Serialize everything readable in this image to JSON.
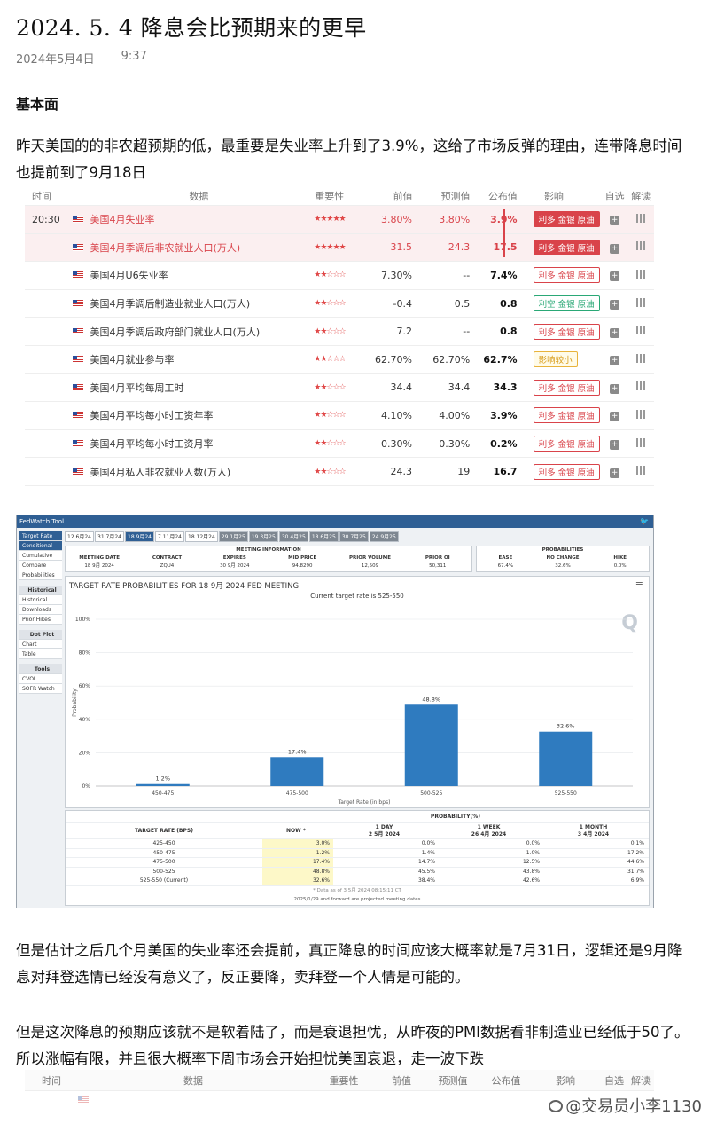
{
  "article": {
    "title": "2024. 5. 4  降息会比预期来的更早",
    "date": "2024年5月4日",
    "time": "9:37",
    "section_title": "基本面",
    "para1": "昨天美国的的非农超预期的低，最重要是失业率上升到了3.9%，这给了市场反弹的理由，连带降息时间也提前到了9月18日",
    "para2": "但是估计之后几个月美国的失业率还会提前，真正降息的时间应该大概率就是7月31日，逻辑还是9月降息对拜登选情已经没有意义了，反正要降，卖拜登一个人情是可能的。",
    "para3": "但是这次降息的预期应该就不是软着陆了，而是衰退担忧，从昨夜的PMI数据看非制造业已经低于50了。所以涨幅有限，并且很大概率下周市场会开始担忧美国衰退，走一波下跌"
  },
  "calendar": {
    "headers": {
      "time": "时间",
      "data": "数据",
      "importance": "重要性",
      "prev": "前值",
      "forecast": "预测值",
      "actual": "公布值",
      "impact": "影响",
      "watch": "自选",
      "explain": "解读"
    },
    "rows": [
      {
        "time": "20:30",
        "name": "美国4月失业率",
        "stars": "★★★★★",
        "prev": "3.80%",
        "forecast": "3.80%",
        "actual": "3.9%",
        "impact": "利多 金银 原油",
        "style": "solid",
        "hl": true
      },
      {
        "time": "",
        "name": "美国4月季调后非农就业人口(万人)",
        "stars": "★★★★★",
        "prev": "31.5",
        "forecast": "24.3",
        "actual": "17.5",
        "impact": "利多 金银 原油",
        "style": "solid",
        "hl": true
      },
      {
        "time": "",
        "name": "美国4月U6失业率",
        "stars": "★★☆☆☆",
        "prev": "7.30%",
        "forecast": "--",
        "actual": "7.4%",
        "impact": "利多 金银 原油",
        "style": "outline",
        "hl": false
      },
      {
        "time": "",
        "name": "美国4月季调后制造业就业人口(万人)",
        "stars": "★★☆☆☆",
        "prev": "-0.4",
        "forecast": "0.5",
        "actual": "0.8",
        "impact": "利空 金银 原油",
        "style": "green",
        "hl": false
      },
      {
        "time": "",
        "name": "美国4月季调后政府部门就业人口(万人)",
        "stars": "★★☆☆☆",
        "prev": "7.2",
        "forecast": "--",
        "actual": "0.8",
        "impact": "利多 金银 原油",
        "style": "outline",
        "hl": false
      },
      {
        "time": "",
        "name": "美国4月就业参与率",
        "stars": "★★☆☆☆",
        "prev": "62.70%",
        "forecast": "62.70%",
        "actual": "62.7%",
        "impact": "影响较小",
        "style": "yellow",
        "hl": false
      },
      {
        "time": "",
        "name": "美国4月平均每周工时",
        "stars": "★★☆☆☆",
        "prev": "34.4",
        "forecast": "34.4",
        "actual": "34.3",
        "impact": "利多 金银 原油",
        "style": "outline",
        "hl": false
      },
      {
        "time": "",
        "name": "美国4月平均每小时工资年率",
        "stars": "★★☆☆☆",
        "prev": "4.10%",
        "forecast": "4.00%",
        "actual": "3.9%",
        "impact": "利多 金银 原油",
        "style": "outline",
        "hl": false
      },
      {
        "time": "",
        "name": "美国4月平均每小时工资月率",
        "stars": "★★☆☆☆",
        "prev": "0.30%",
        "forecast": "0.30%",
        "actual": "0.2%",
        "impact": "利多 金银 原油",
        "style": "outline",
        "hl": false
      },
      {
        "time": "",
        "name": "美国4月私人非农就业人数(万人)",
        "stars": "★★☆☆☆",
        "prev": "24.3",
        "forecast": "19",
        "actual": "16.7",
        "impact": "利多 金银 原油",
        "style": "outline",
        "hl": false
      }
    ]
  },
  "fedwatch": {
    "app_title": "FedWatch Tool",
    "twitter": "🐦",
    "tabs": [
      "12 6月24",
      "31 7月24",
      "18 9月24",
      "7 11月24",
      "18 12月24",
      "29 1月25",
      "19 3月25",
      "30 4月25",
      "18 6月25",
      "30 7月25",
      "24 9月25"
    ],
    "side_top": "Target Rate",
    "side_items": [
      "Conditional",
      "Cumulative",
      "Compare",
      "Probabilities"
    ],
    "side_hist": "Historical",
    "side_hist_items": [
      "Historical",
      "Downloads",
      "Prior Hikes"
    ],
    "side_dot": "Dot Plot",
    "side_dot_items": [
      "Chart",
      "Table"
    ],
    "side_tools": "Tools",
    "side_tools_items": [
      "CVOL",
      "SOFR Watch"
    ],
    "meeting_info_label": "MEETING INFORMATION",
    "meeting_headers": [
      "MEETING DATE",
      "CONTRACT",
      "EXPIRES",
      "MID PRICE",
      "PRIOR VOLUME",
      "PRIOR OI"
    ],
    "meeting_values": [
      "18 9月 2024",
      "ZQU4",
      "30 9月 2024",
      "94.8290",
      "12,509",
      "50,311"
    ],
    "prob_label": "PROBABILITIES",
    "prob_headers": [
      "EASE",
      "NO CHANGE",
      "HIKE"
    ],
    "prob_values": [
      "67.4%",
      "32.6%",
      "0.0%"
    ],
    "menu_icon": "≡",
    "logo_glyph": "Q",
    "table": {
      "col_target": "TARGET RATE (BPS)",
      "col_prob": "PROBABILITY(%)",
      "col_now": "NOW *",
      "col_1day": "1 DAY",
      "col_1day_date": "2 5月 2024",
      "col_1week": "1 WEEK",
      "col_1week_date": "26 4月 2024",
      "col_1month": "1 MONTH",
      "col_1month_date": "3 4月 2024",
      "rows": [
        {
          "rate": "425-450",
          "now": "3.0%",
          "d1": "0.0%",
          "w1": "0.0%",
          "m1": "0.1%"
        },
        {
          "rate": "450-475",
          "now": "1.2%",
          "d1": "1.4%",
          "w1": "1.0%",
          "m1": "17.2%"
        },
        {
          "rate": "475-500",
          "now": "17.4%",
          "d1": "14.7%",
          "w1": "12.5%",
          "m1": "44.6%"
        },
        {
          "rate": "500-525",
          "now": "48.8%",
          "d1": "45.5%",
          "w1": "43.8%",
          "m1": "31.7%"
        },
        {
          "rate": "525-550 (Current)",
          "now": "32.6%",
          "d1": "38.4%",
          "w1": "42.6%",
          "m1": "6.9%"
        }
      ],
      "note": "* Data as of 3 5月 2024 08:15:11 CT",
      "footer": "2025/1/29 and forward are projected meeting dates"
    }
  },
  "chart_data": {
    "type": "bar",
    "title": "TARGET RATE PROBABILITIES FOR 18 9月 2024 FED MEETING",
    "subtitle": "Current target rate is 525-550",
    "categories": [
      "450-475",
      "475-500",
      "500-525",
      "525-550"
    ],
    "values": [
      1.2,
      17.4,
      48.8,
      32.6
    ],
    "data_labels": [
      "1.2%",
      "17.4%",
      "48.8%",
      "32.6%"
    ],
    "xlabel": "Target Rate (in bps)",
    "ylabel": "Probability",
    "yticks": [
      "0%",
      "20%",
      "40%",
      "60%",
      "80%",
      "100%"
    ],
    "ylim": [
      0,
      100
    ],
    "bar_color": "#2f7bbf",
    "grid": true
  },
  "calendar2": {
    "headers": [
      "时间",
      "数据",
      "重要性",
      "前值",
      "预测值",
      "公布值",
      "影响",
      "自选",
      "解读"
    ]
  },
  "watermark": "@交易员小李1130"
}
